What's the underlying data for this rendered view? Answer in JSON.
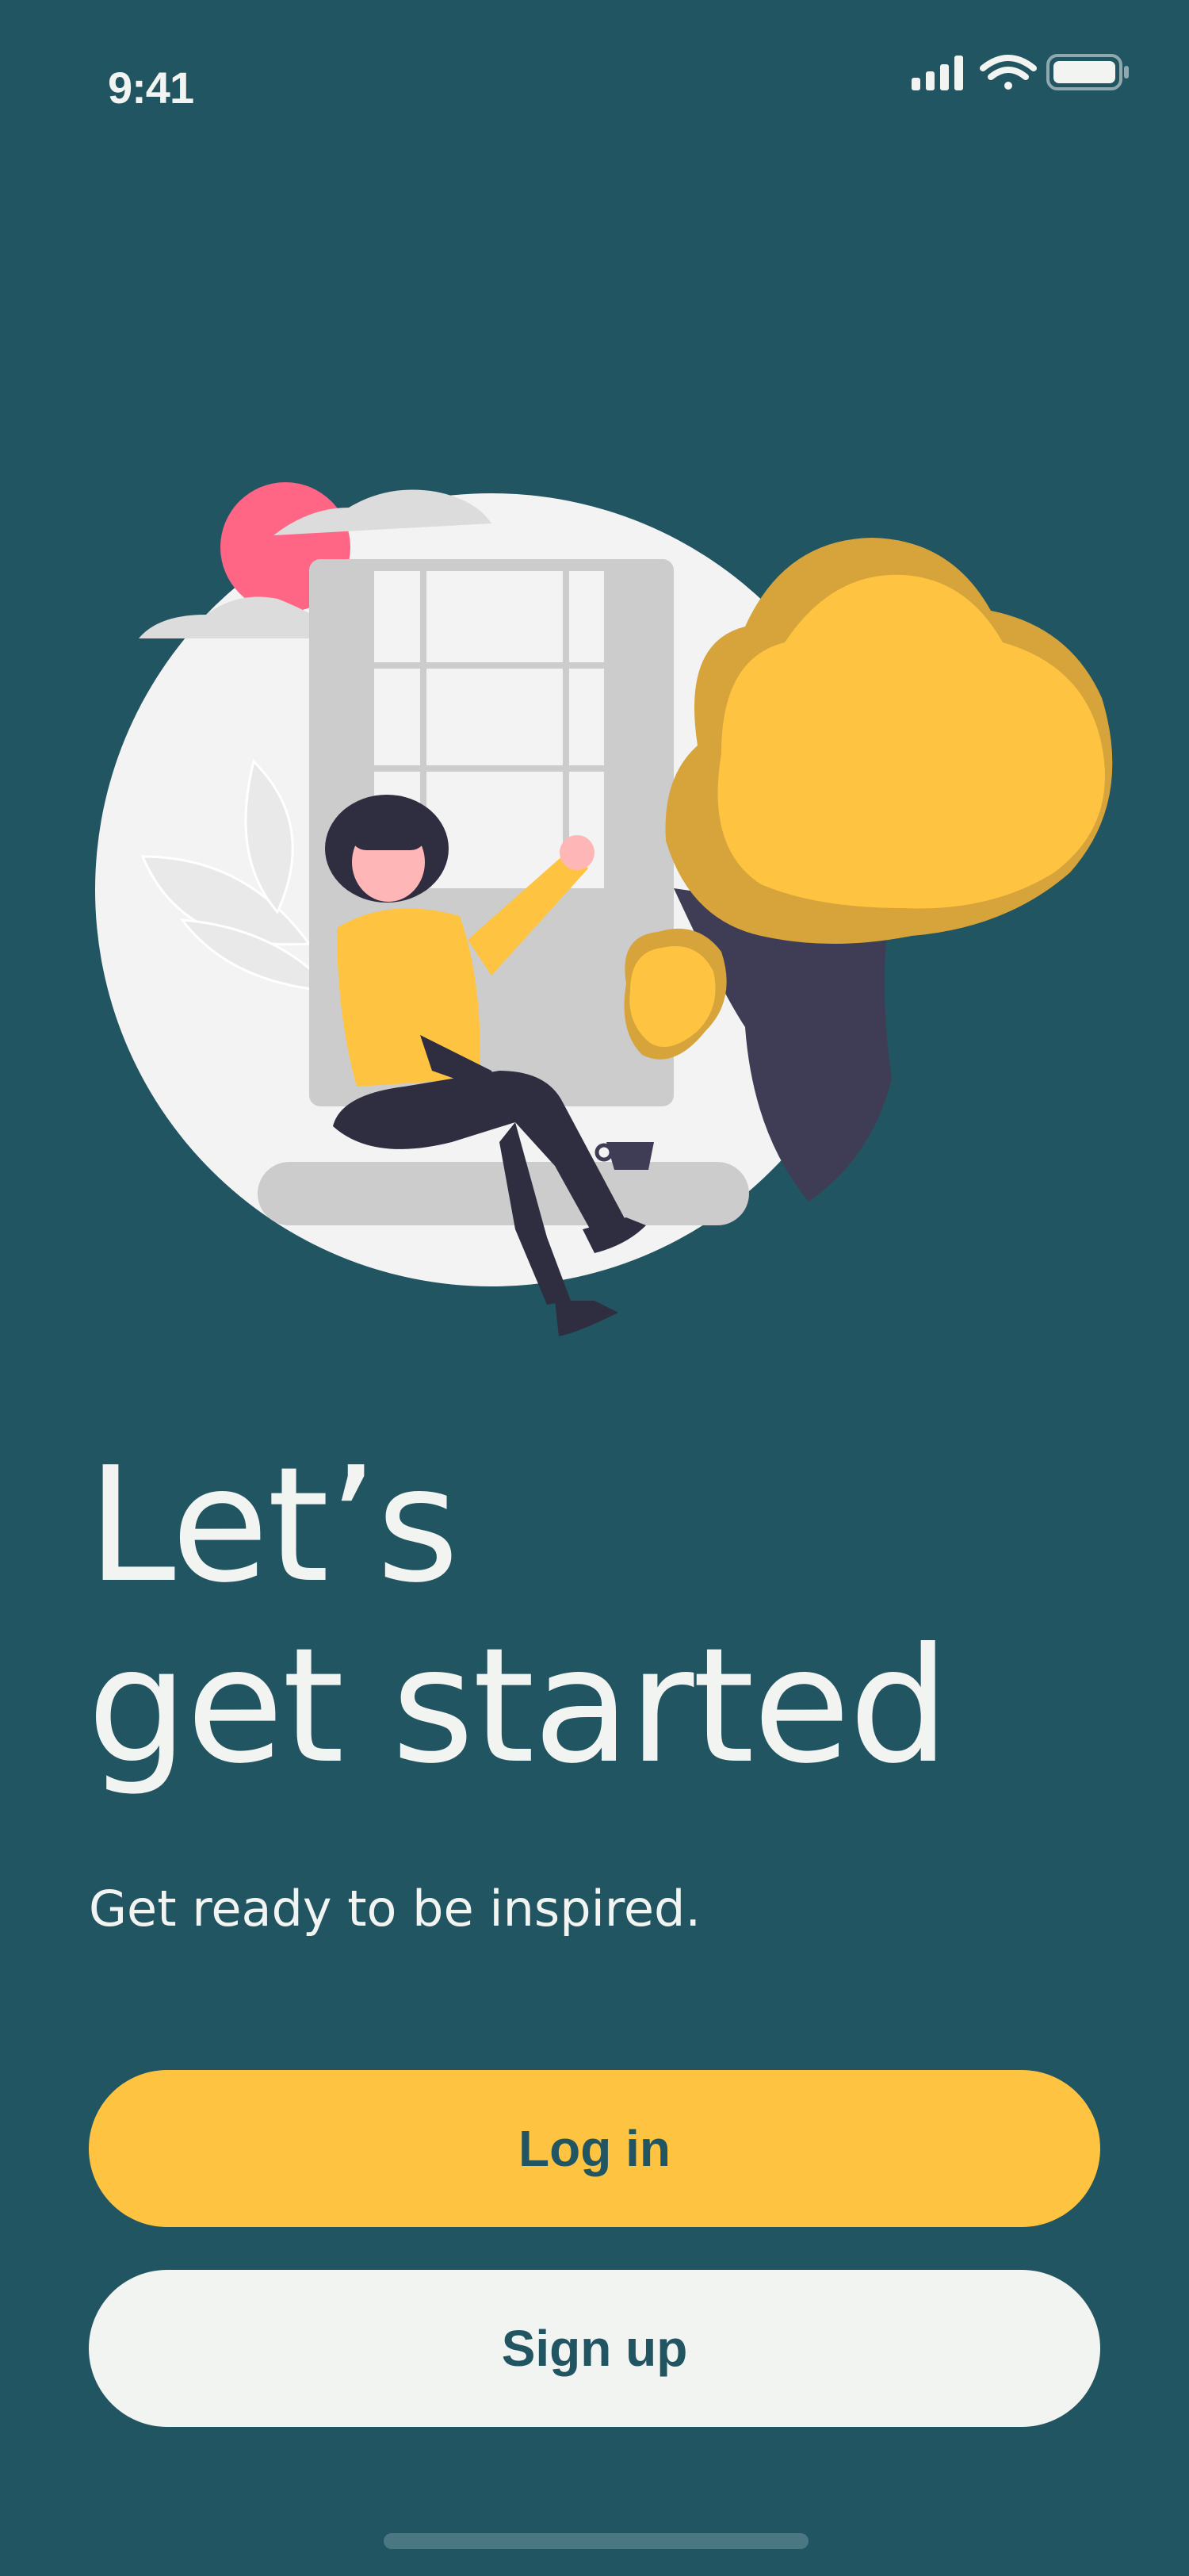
{
  "status_bar": {
    "time": "9:41",
    "icons": [
      "cellular-signal-icon",
      "wifi-icon",
      "battery-icon"
    ]
  },
  "illustration": {
    "name": "woman-sitting-on-window-ledge-illustration"
  },
  "main": {
    "title_line1": "Let’s",
    "title_line2": "get started",
    "subtitle": "Get ready to be inspired."
  },
  "actions": {
    "login_label": "Log in",
    "signup_label": "Sign up"
  },
  "colors": {
    "background": "#225562",
    "primary_button": "#fec441",
    "secondary_button": "#f1f4f1",
    "text_light": "#f2f4f1",
    "button_text": "#225562"
  }
}
